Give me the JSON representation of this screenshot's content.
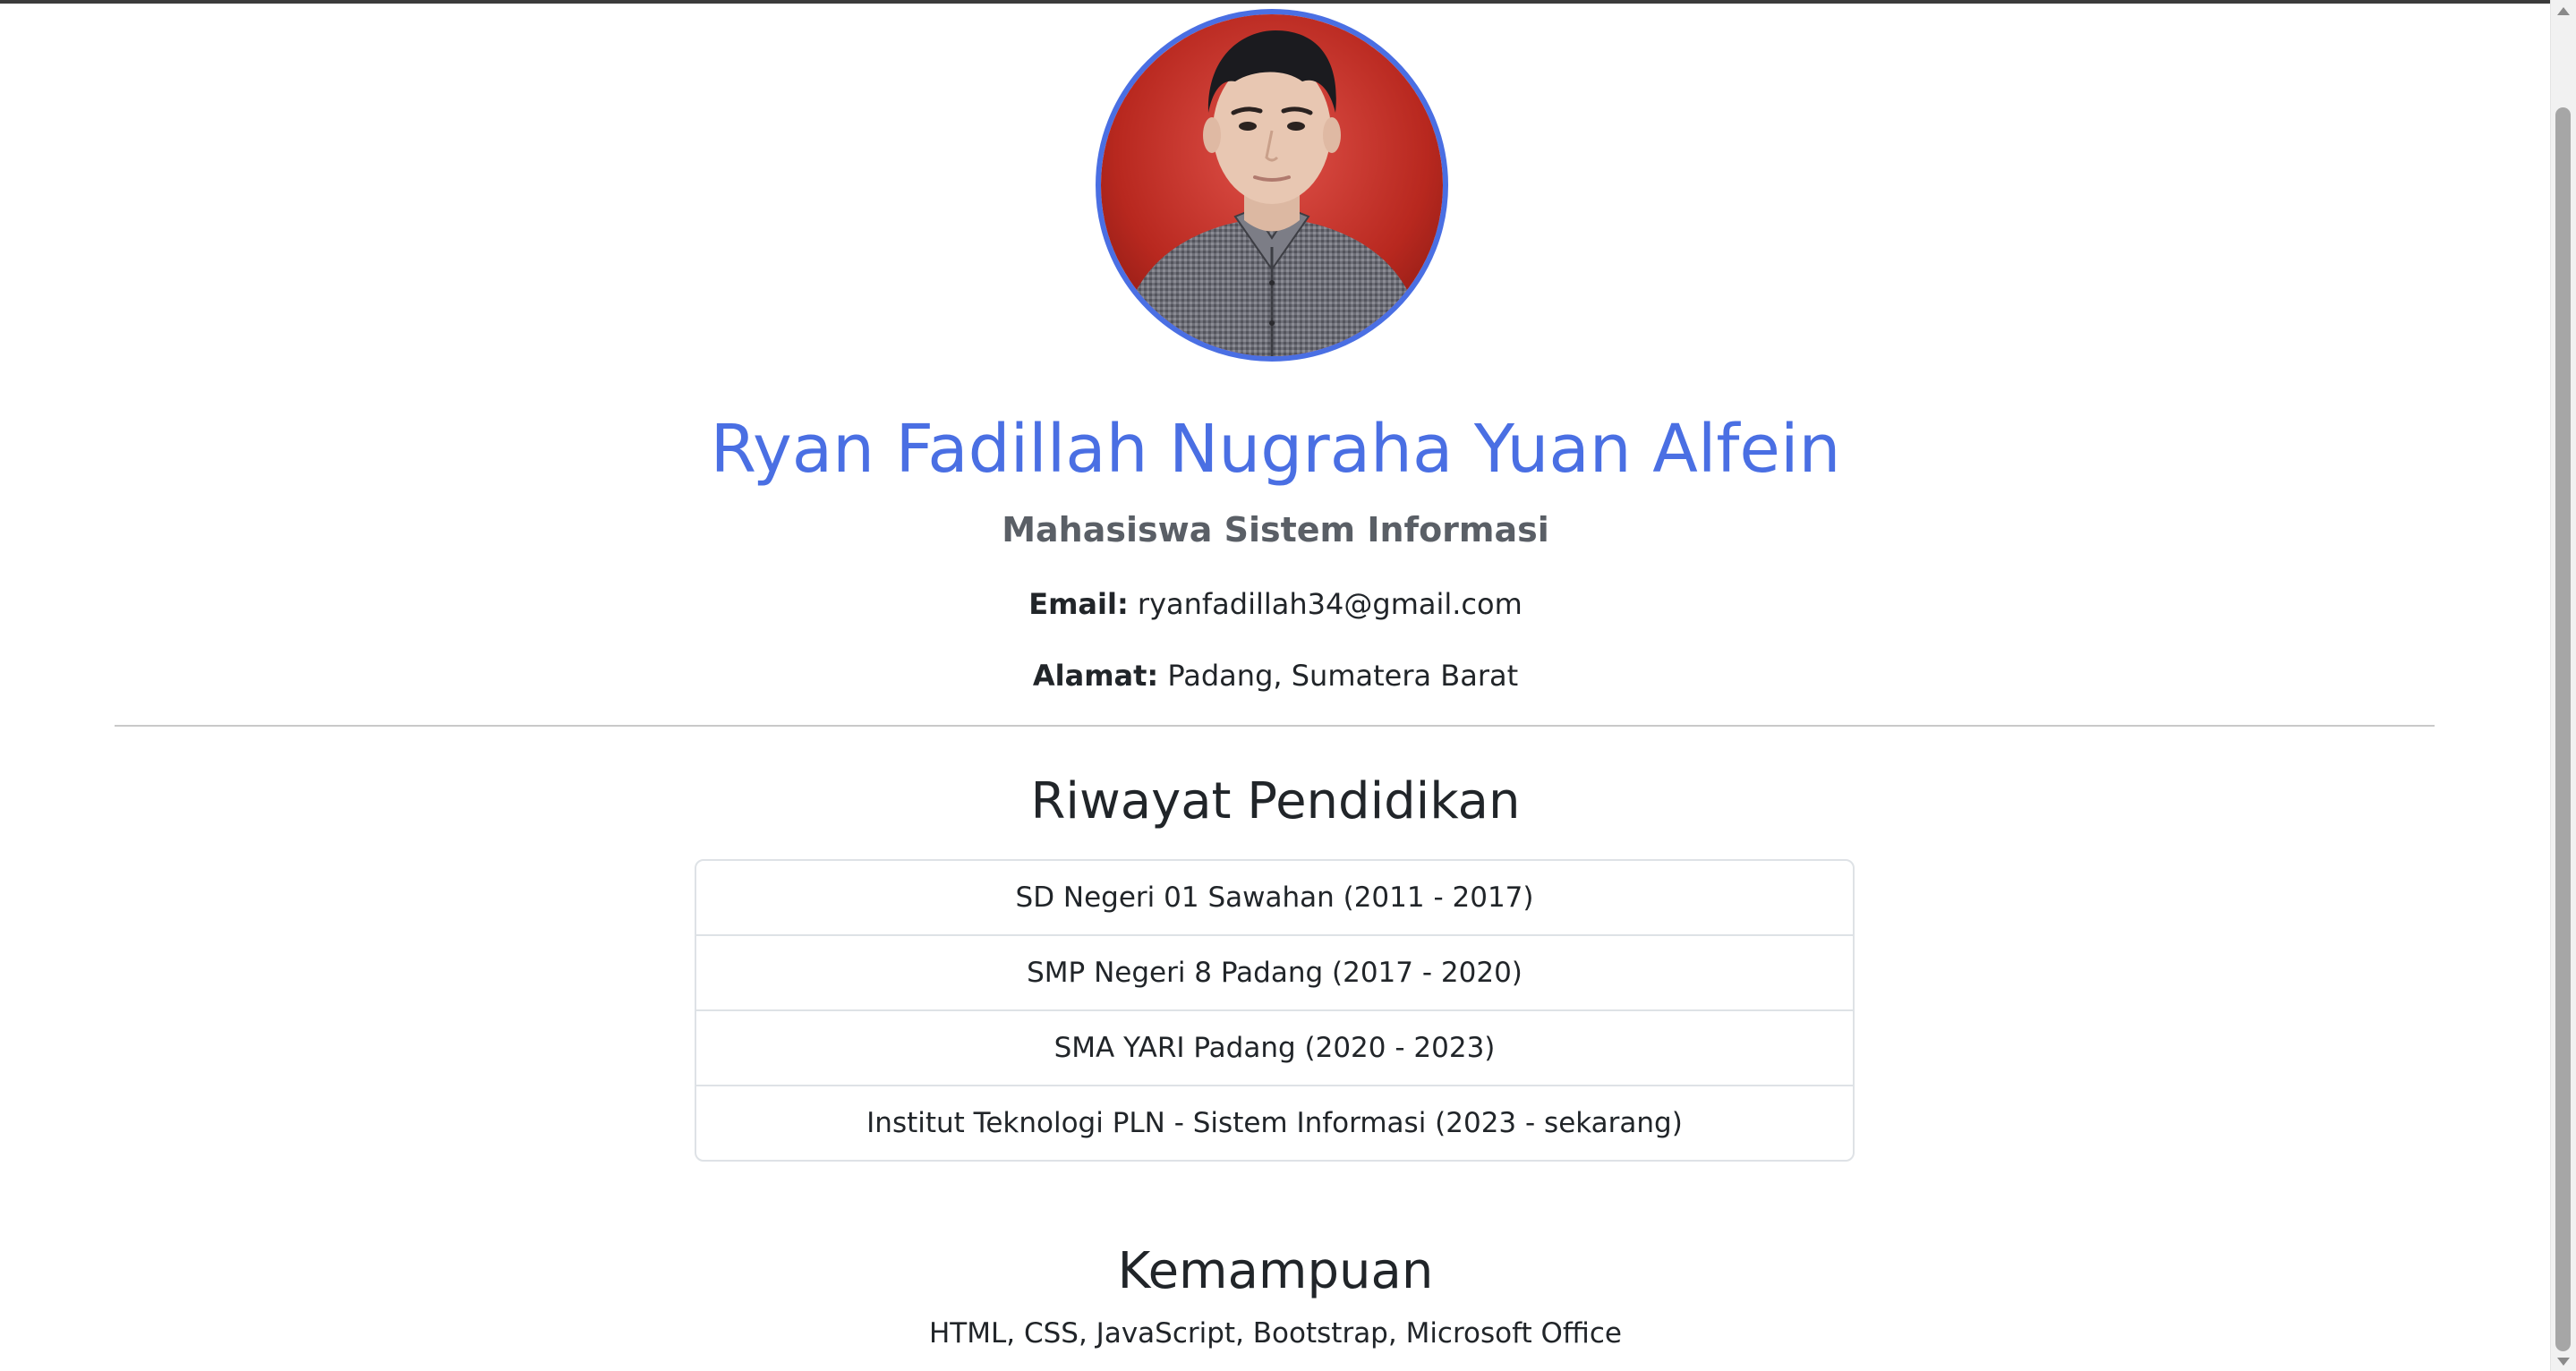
{
  "profile": {
    "name": "Ryan Fadillah Nugraha Yuan Alfein",
    "role": "Mahasiswa Sistem Informasi",
    "email_label": "Email:",
    "email": "ryanfadillah34@gmail.com",
    "address_label": "Alamat:",
    "address": "Padang, Sumatera Barat",
    "avatar_icon": "profile-photo"
  },
  "education": {
    "title": "Riwayat Pendidikan",
    "items": [
      "SD Negeri 01 Sawahan (2011 - 2017)",
      "SMP Negeri 8 Padang (2017 - 2020)",
      "SMA YARI Padang (2020 - 2023)",
      "Institut Teknologi PLN - Sistem Informasi (2023 - sekarang)"
    ]
  },
  "skills": {
    "title": "Kemampuan",
    "text": "HTML, CSS, JavaScript, Bootstrap, Microsoft Office"
  },
  "colors": {
    "accent": "#4a6fe3",
    "subtitle": "#5a5f66",
    "text": "#212529",
    "border": "#dee2e6",
    "photo_background": "#c0392b"
  }
}
